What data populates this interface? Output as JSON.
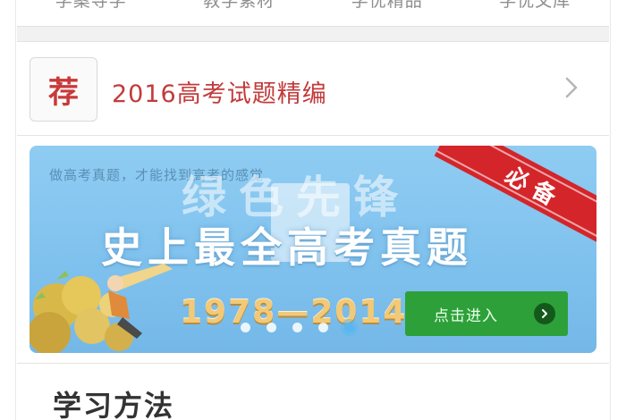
{
  "tabs": [
    {
      "label": "学案导学"
    },
    {
      "label": "教学素材"
    },
    {
      "label": "学优精品"
    },
    {
      "label": "学优文库"
    }
  ],
  "recommend": {
    "badge": "荐",
    "title": "2016高考试题精编",
    "chevron_icon": "chevron-right-icon"
  },
  "banner": {
    "subtitle": "做高考真题，才能找到高考的感觉",
    "headline": "史上最全高考真题",
    "watermark": "绿色先锋",
    "years": "1978—2014",
    "ribbon": "必备",
    "enter_label": "点击进入",
    "enter_icon": "arrow-right-circle-icon",
    "carousel": {
      "count": 5,
      "active_index": 4
    },
    "colors": {
      "sky": "#8fccf2",
      "ribbon": "#d4252a",
      "button": "#2ea03a",
      "years": "#f1c978"
    }
  },
  "section": {
    "title": "学习方法"
  },
  "colors": {
    "accent_red": "#c23b3b",
    "background": "#f1f1f1"
  }
}
